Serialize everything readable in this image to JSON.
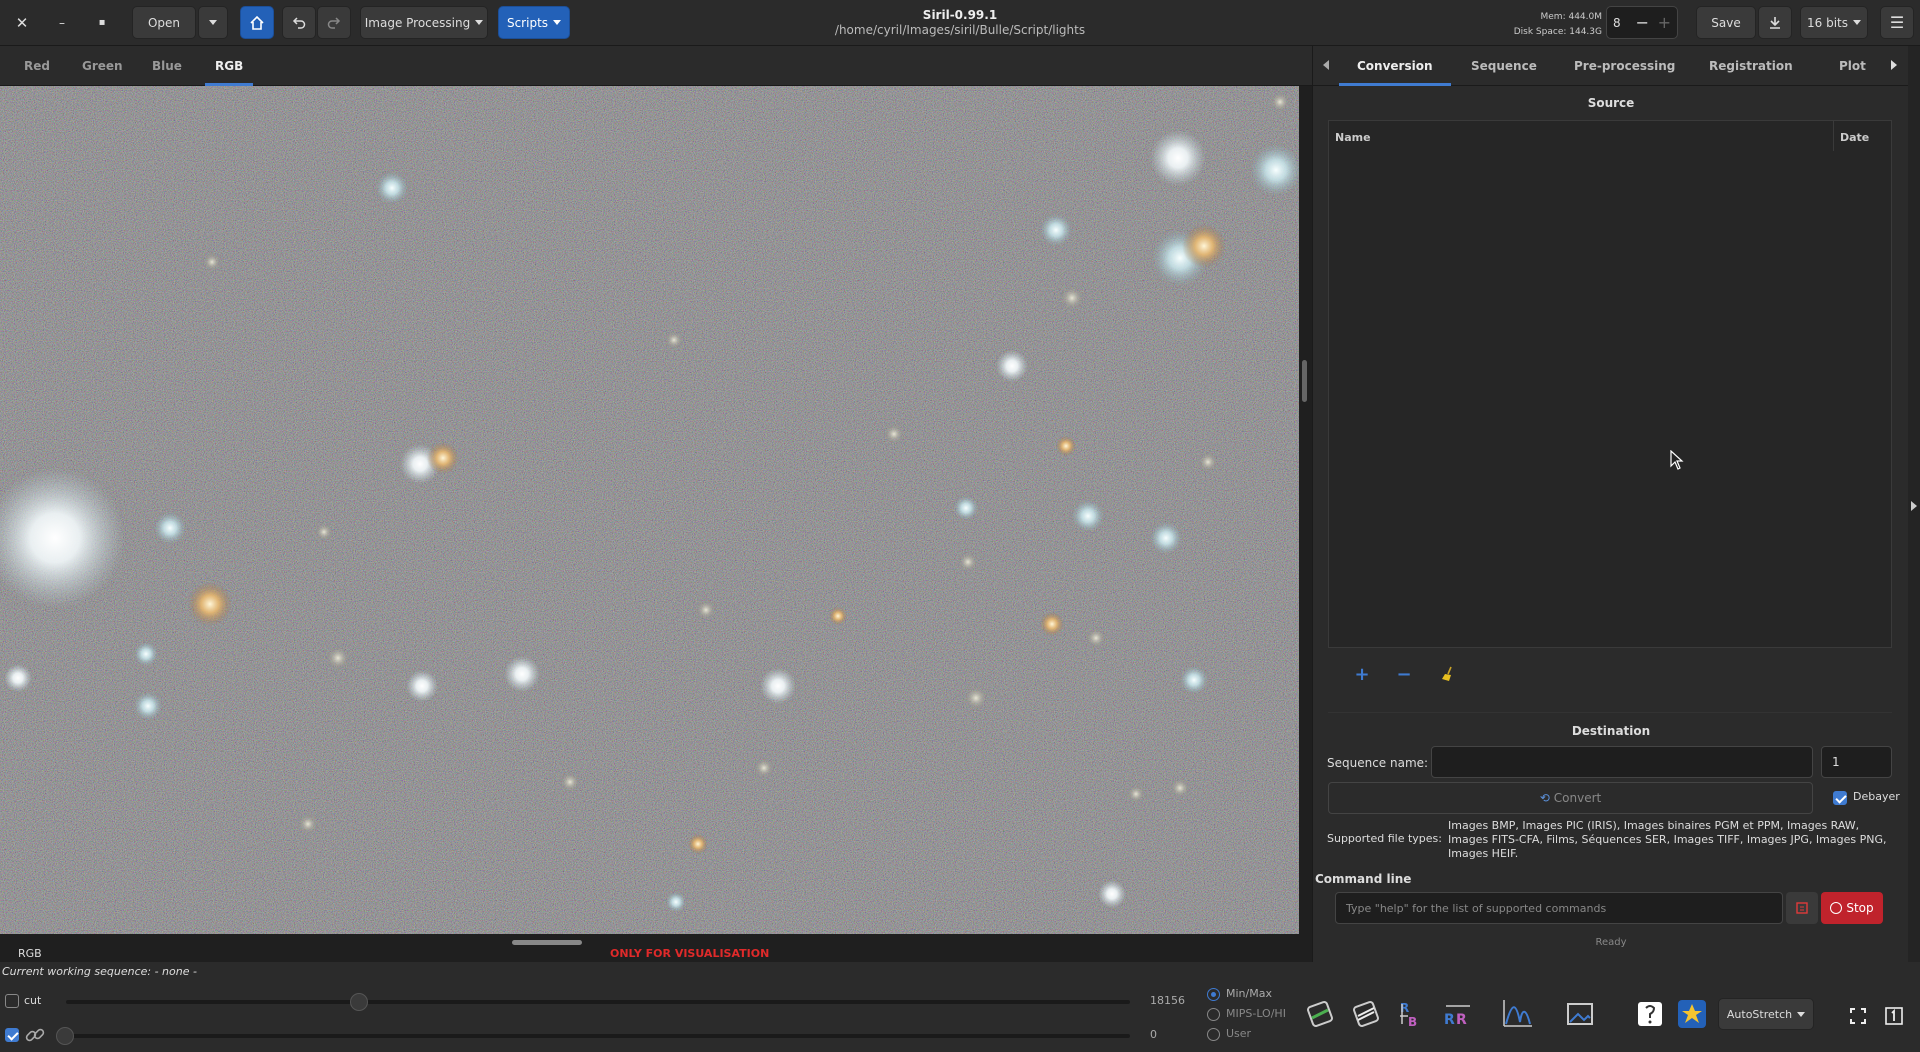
{
  "app": {
    "name": "Siril-0.99.1",
    "path": "/home/cyril/Images/siril/Bulle/Script/lights"
  },
  "header": {
    "open": "Open",
    "image_processing": "Image Processing",
    "scripts": "Scripts",
    "mem": "Mem: 444.0M",
    "disk": "Disk Space: 144.3G",
    "threads": "8",
    "save": "Save",
    "bits": "16 bits"
  },
  "view_tabs": [
    "Red",
    "Green",
    "Blue",
    "RGB"
  ],
  "viewer": {
    "channel": "RGB",
    "warning": "ONLY FOR VISUALISATION",
    "working_sequence": "Current working sequence: - none -"
  },
  "panel_tabs": [
    "Conversion",
    "Sequence",
    "Pre-processing",
    "Registration",
    "Plot"
  ],
  "conversion": {
    "source_title": "Source",
    "col_name": "Name",
    "col_date": "Date",
    "destination_title": "Destination",
    "seq_name_label": "Sequence name:",
    "seq_name_value": "",
    "start_index": "1",
    "convert": "Convert",
    "debayer": "Debayer",
    "ftypes_label": "Supported file types:",
    "ftypes": "Images BMP, Images PIC (IRIS), Images binaires PGM et PPM, Images RAW, Images FITS-CFA, Films, Séquences SER, Images TIFF, Images JPG, Images PNG, Images HEIF."
  },
  "command": {
    "title": "Command line",
    "placeholder": "Type \"help\" for the list of supported commands",
    "stop": "Stop",
    "status": "Ready"
  },
  "display": {
    "cut": "cut",
    "hi_value": "18156",
    "lo_value": "0",
    "modes": [
      "Min/Max",
      "MIPS-LO/HI",
      "User"
    ],
    "stretch": "AutoStretch"
  },
  "colors": {
    "accent": "#3f7bd1",
    "stop": "#c0232c",
    "warning": "#e02a2a",
    "toolbar_blue": "#2361b8"
  }
}
